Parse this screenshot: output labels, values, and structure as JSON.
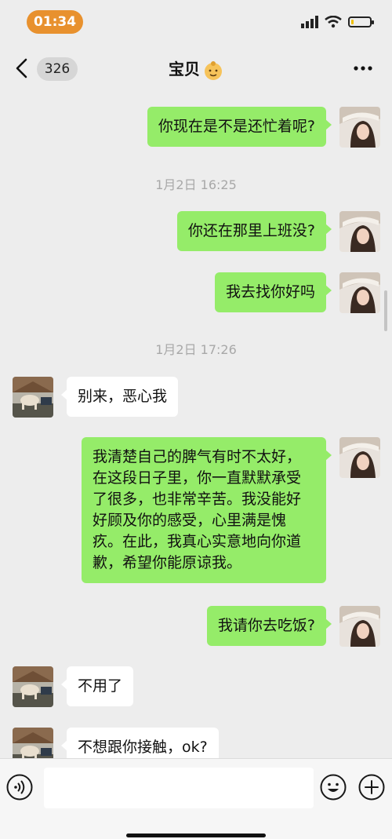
{
  "status_bar": {
    "time": "01:34",
    "battery_level": 0.15
  },
  "nav": {
    "unread_count": "326",
    "title": "宝贝"
  },
  "messages": [
    {
      "side": "me",
      "text": "你现在是不是还忙着呢?"
    },
    {
      "timestamp": "1月2日 16:25"
    },
    {
      "side": "me",
      "text": "你还在那里上班没?"
    },
    {
      "side": "me",
      "text": "我去找你好吗"
    },
    {
      "timestamp": "1月2日 17:26"
    },
    {
      "side": "them",
      "text": "别来，恶心我"
    },
    {
      "side": "me",
      "lines": [
        "我清楚自己的脾气有时不太好，",
        "在这段日子里，你一直默默承受",
        "了很多，也非常辛苦。我没能好",
        "好顾及你的感受，心里满是愧",
        "疚。在此，我真心实意地向你道",
        "歉，希望你能原谅我。"
      ]
    },
    {
      "side": "me",
      "text": "我请你去吃饭?"
    },
    {
      "side": "them",
      "text": "不用了"
    },
    {
      "side": "them",
      "text": "不想跟你接触，ok?"
    }
  ],
  "input": {
    "value": ""
  },
  "colors": {
    "me_bubble": "#95ec69",
    "them_bubble": "#ffffff",
    "time_pill": "#e8912e",
    "background": "#ededed"
  },
  "icons": {
    "back": "chevron-left-icon",
    "more": "more-dots-icon",
    "voice": "voice-icon",
    "emoji": "emoji-icon",
    "plus": "plus-icon"
  }
}
